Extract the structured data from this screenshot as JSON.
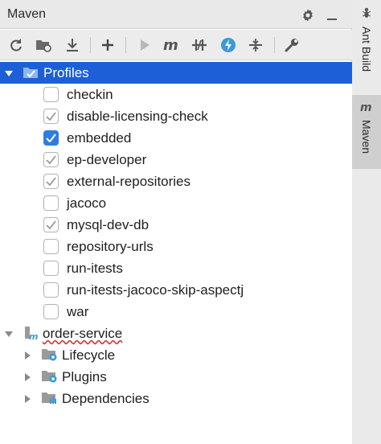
{
  "panel": {
    "title": "Maven"
  },
  "toolbar": {
    "buttons": [
      "reload-icon",
      "generate-sources-icon",
      "download-icon",
      "add-icon",
      "run-icon",
      "execute-goal-icon",
      "toggle-offline-icon",
      "toggle-skip-tests-icon",
      "collapse-all-icon",
      "settings-wrench-icon"
    ]
  },
  "tree": {
    "profiles_label": "Profiles",
    "profiles": [
      {
        "name": "checkin",
        "state": "unchecked"
      },
      {
        "name": "disable-licensing-check",
        "state": "implicit"
      },
      {
        "name": "embedded",
        "state": "checked"
      },
      {
        "name": "ep-developer",
        "state": "implicit"
      },
      {
        "name": "external-repositories",
        "state": "implicit"
      },
      {
        "name": "jacoco",
        "state": "unchecked"
      },
      {
        "name": "mysql-dev-db",
        "state": "implicit"
      },
      {
        "name": "repository-urls",
        "state": "unchecked"
      },
      {
        "name": "run-itests",
        "state": "unchecked"
      },
      {
        "name": "run-itests-jacoco-skip-aspectj",
        "state": "unchecked"
      },
      {
        "name": "war",
        "state": "unchecked"
      }
    ],
    "project": "order-service",
    "children": [
      "Lifecycle",
      "Plugins",
      "Dependencies"
    ]
  },
  "side_tabs": {
    "ant_build": "Ant Build",
    "maven": "Maven"
  },
  "colors": {
    "selection": "#1d5fd6",
    "checkbox_checked": "#2f7ddf",
    "accent_bolt": "#3a9ad9"
  }
}
